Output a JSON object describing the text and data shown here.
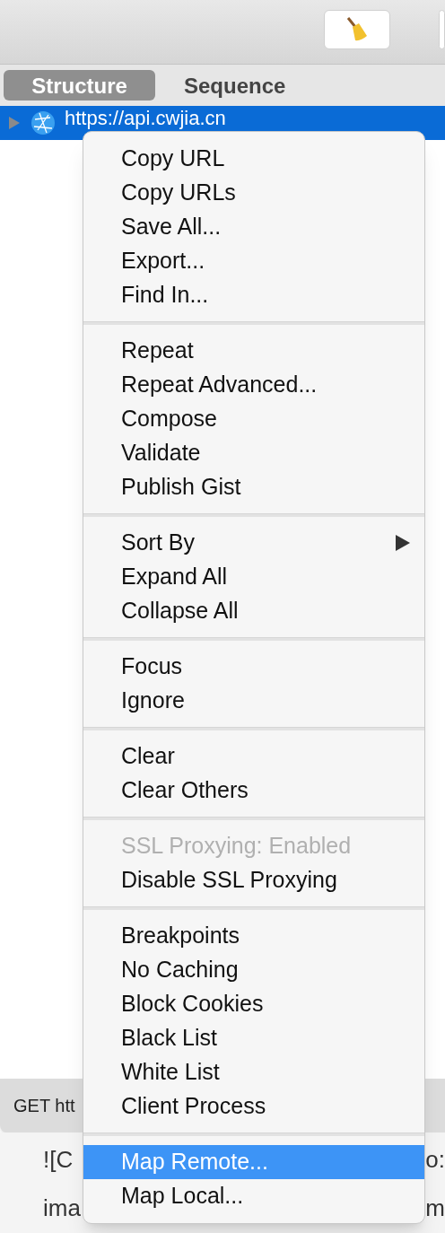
{
  "tabs": [
    {
      "label": "Structure",
      "selected": true
    },
    {
      "label": "Sequence",
      "selected": false
    }
  ],
  "tree": [
    {
      "label": "https://api.cwjia.cn",
      "selected": true,
      "expanded": false
    }
  ],
  "status_bar": {
    "text": "GET htt"
  },
  "background_lines": [
    {
      "left": "![C",
      "right": "o:"
    },
    {
      "left": "ima",
      "right": "m"
    }
  ],
  "context_menu": {
    "groups": [
      [
        {
          "label": "Copy URL",
          "disabled": false,
          "selected": false,
          "submenu": false
        },
        {
          "label": "Copy URLs",
          "disabled": false,
          "selected": false,
          "submenu": false
        },
        {
          "label": "Save All...",
          "disabled": false,
          "selected": false,
          "submenu": false
        },
        {
          "label": "Export...",
          "disabled": false,
          "selected": false,
          "submenu": false
        },
        {
          "label": "Find In...",
          "disabled": false,
          "selected": false,
          "submenu": false
        }
      ],
      [
        {
          "label": "Repeat",
          "disabled": false,
          "selected": false,
          "submenu": false
        },
        {
          "label": "Repeat Advanced...",
          "disabled": false,
          "selected": false,
          "submenu": false
        },
        {
          "label": "Compose",
          "disabled": false,
          "selected": false,
          "submenu": false
        },
        {
          "label": "Validate",
          "disabled": false,
          "selected": false,
          "submenu": false
        },
        {
          "label": "Publish Gist",
          "disabled": false,
          "selected": false,
          "submenu": false
        }
      ],
      [
        {
          "label": "Sort By",
          "disabled": false,
          "selected": false,
          "submenu": true
        },
        {
          "label": "Expand All",
          "disabled": false,
          "selected": false,
          "submenu": false
        },
        {
          "label": "Collapse All",
          "disabled": false,
          "selected": false,
          "submenu": false
        }
      ],
      [
        {
          "label": "Focus",
          "disabled": false,
          "selected": false,
          "submenu": false
        },
        {
          "label": "Ignore",
          "disabled": false,
          "selected": false,
          "submenu": false
        }
      ],
      [
        {
          "label": "Clear",
          "disabled": false,
          "selected": false,
          "submenu": false
        },
        {
          "label": "Clear Others",
          "disabled": false,
          "selected": false,
          "submenu": false
        }
      ],
      [
        {
          "label": "SSL Proxying: Enabled",
          "disabled": true,
          "selected": false,
          "submenu": false
        },
        {
          "label": "Disable SSL Proxying",
          "disabled": false,
          "selected": false,
          "submenu": false
        }
      ],
      [
        {
          "label": "Breakpoints",
          "disabled": false,
          "selected": false,
          "submenu": false
        },
        {
          "label": "No Caching",
          "disabled": false,
          "selected": false,
          "submenu": false
        },
        {
          "label": "Block Cookies",
          "disabled": false,
          "selected": false,
          "submenu": false
        },
        {
          "label": "Black List",
          "disabled": false,
          "selected": false,
          "submenu": false
        },
        {
          "label": "White List",
          "disabled": false,
          "selected": false,
          "submenu": false
        },
        {
          "label": "Client Process",
          "disabled": false,
          "selected": false,
          "submenu": false
        }
      ],
      [
        {
          "label": "Map Remote...",
          "disabled": false,
          "selected": true,
          "submenu": false
        },
        {
          "label": "Map Local...",
          "disabled": false,
          "selected": false,
          "submenu": false
        }
      ]
    ]
  }
}
